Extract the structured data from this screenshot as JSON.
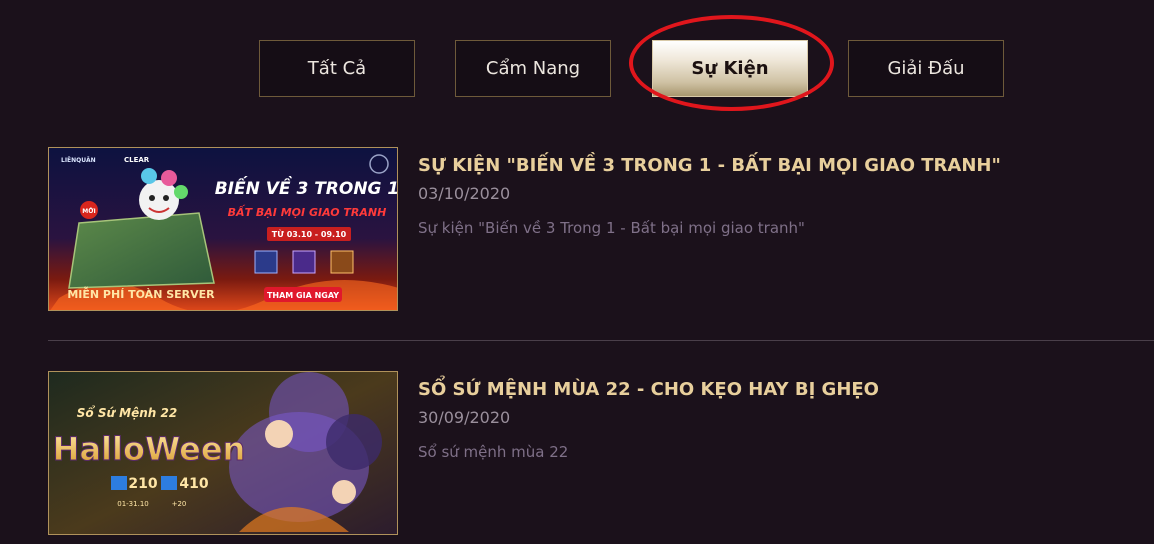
{
  "tabs": [
    {
      "label": "Tất Cả",
      "active": false
    },
    {
      "label": "Cẩm Nang",
      "active": false
    },
    {
      "label": "Sự Kiện",
      "active": true
    },
    {
      "label": "Giải Đấu",
      "active": false
    }
  ],
  "articles": [
    {
      "title": "SỰ KIỆN \"BIẾN VỀ 3 TRONG 1 - BẤT BẠI MỌI GIAO TRANH\"",
      "date": "03/10/2020",
      "description": "Sự kiện \"Biến về 3 Trong 1 - Bất bại mọi giao tranh\"",
      "banner": {
        "logo": "LIÊNQUÂN",
        "partner": "CLEAR",
        "headline": "BIẾN VỀ 3 TRONG 1",
        "subhead": "BẤT BẠI MỌI GIAO TRANH",
        "dates": "TỪ 03.10 - 09.10",
        "free_text": "MIỄN PHÍ TOÀN SERVER",
        "cta": "THAM GIA NGAY",
        "badge": "MỚI"
      }
    },
    {
      "title": "SỔ SỨ MỆNH MÙA 22 - CHO KẸO HAY BỊ GHẸO",
      "date": "30/09/2020",
      "description": "Sổ sứ mệnh mùa 22",
      "banner": {
        "top_text": "Sổ Sứ Mệnh 22",
        "headline": "HalloWeen",
        "price1": "210",
        "price2": "410",
        "date_range": "01-31.10",
        "bonus": "+20"
      }
    }
  ],
  "colors": {
    "background": "#1b111b",
    "title": "#e8cf9c",
    "highlight": "#e0161c"
  }
}
